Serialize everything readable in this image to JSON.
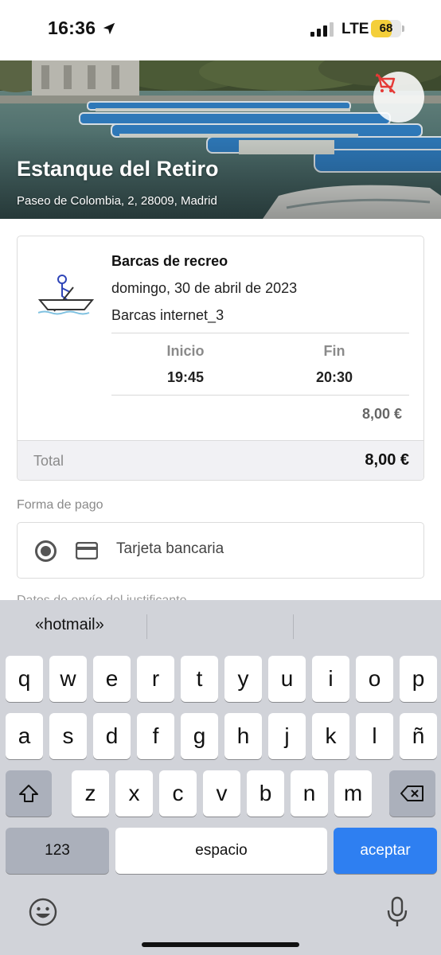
{
  "status_bar": {
    "time": "16:36",
    "network": "LTE",
    "battery_level": "68",
    "battery_percent": 68
  },
  "venue": {
    "name": "Estanque del Retiro",
    "address": "Paseo de Colombia, 2, 28009, Madrid"
  },
  "booking": {
    "activity": "Barcas de recreo",
    "date": "domingo, 30 de abril de 2023",
    "resource": "Barcas internet_3",
    "start_label": "Inicio",
    "start_time": "19:45",
    "end_label": "Fin",
    "end_time": "20:30",
    "price": "8,00 €",
    "total_label": "Total",
    "total_value": "8,00 €"
  },
  "payment": {
    "section_label": "Forma de pago",
    "method": "Tarjeta bancaria",
    "next_section_label": "Datos de envío del justificante"
  },
  "keyboard": {
    "suggestion": "«hotmail»",
    "row1": [
      "q",
      "w",
      "e",
      "r",
      "t",
      "y",
      "u",
      "i",
      "o",
      "p"
    ],
    "row2": [
      "a",
      "s",
      "d",
      "f",
      "g",
      "h",
      "j",
      "k",
      "l",
      "ñ"
    ],
    "row3": [
      "z",
      "x",
      "c",
      "v",
      "b",
      "n",
      "m"
    ],
    "numbers_key": "123",
    "space_key": "espacio",
    "return_key": "aceptar"
  },
  "colors": {
    "accent_red": "#e53935",
    "accept_blue": "#2e7ff1",
    "battery_yellow": "#f4cf3a",
    "boat_icon_blue": "#2f45b8"
  }
}
